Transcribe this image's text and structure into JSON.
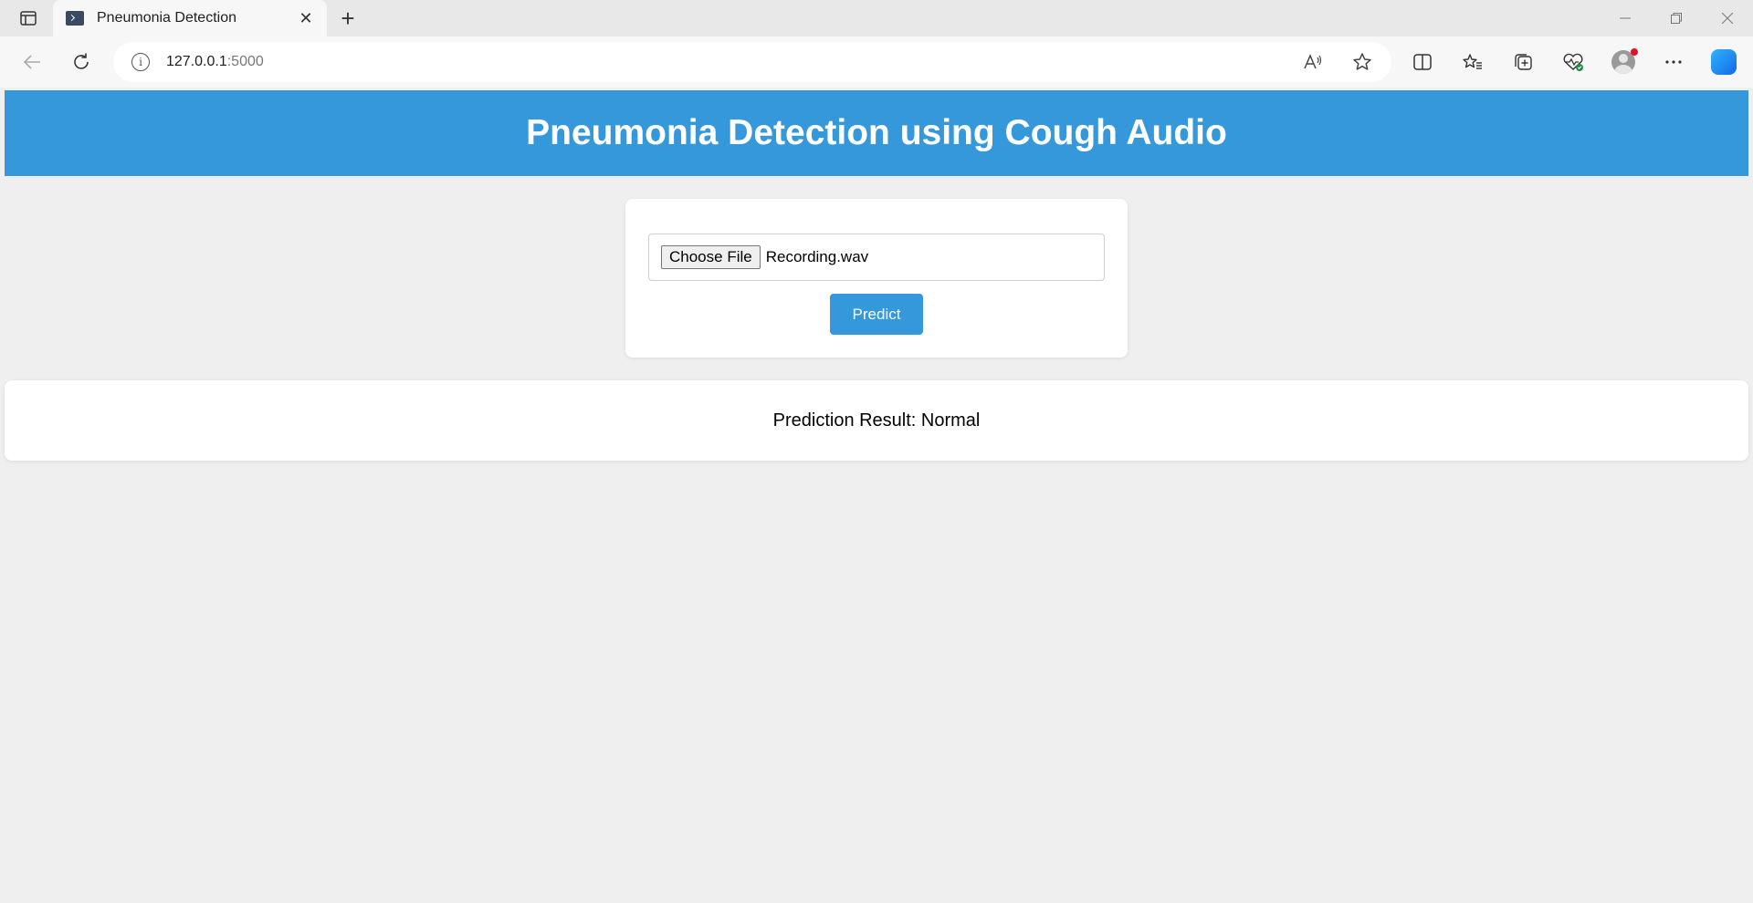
{
  "browser": {
    "tab_title": "Pneumonia Detection",
    "tab_close_glyph": "✕",
    "new_tab_glyph": "+",
    "url_host": "127.0.0.1",
    "url_port": ":5000",
    "icons": [
      "tab-actions-icon",
      "back-icon",
      "refresh-icon",
      "info-icon",
      "read-aloud-icon",
      "favorite-star-icon",
      "split-screen-icon",
      "favorites-icon",
      "collections-icon",
      "browser-essentials-icon",
      "profile-avatar",
      "more-options-icon",
      "copilot-icon"
    ]
  },
  "header": {
    "title": "Pneumonia Detection using Cough Audio",
    "color": "#3498db"
  },
  "upload": {
    "choose_file_label": "Choose File",
    "file_name": "Recording.wav",
    "predict_label": "Predict"
  },
  "result": {
    "text": "Prediction Result: Normal"
  }
}
